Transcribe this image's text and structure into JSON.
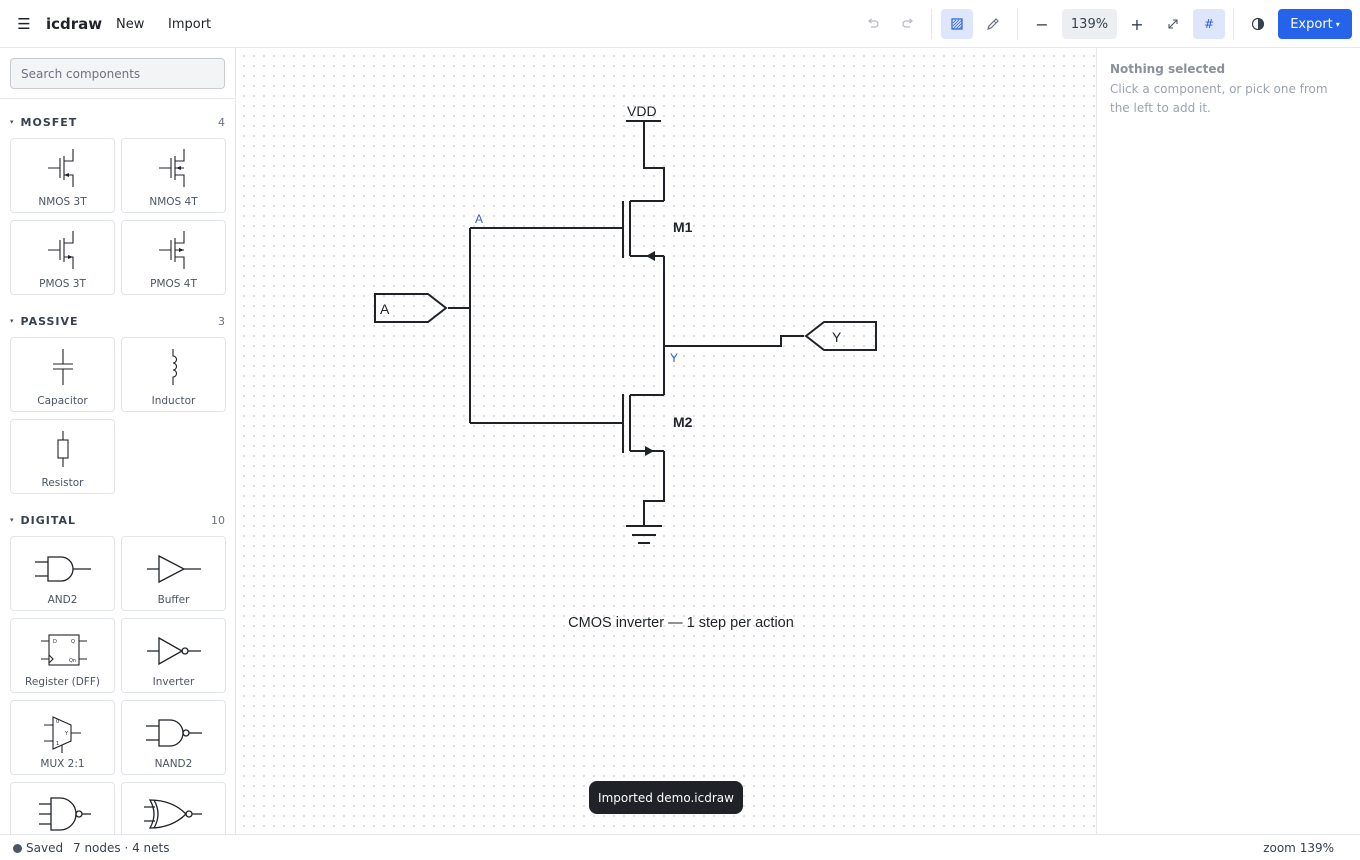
{
  "app": {
    "menu_icon": "hamburger-icon",
    "name": "icdraw",
    "menu": {
      "new": "New",
      "import": "Import"
    }
  },
  "toolbar": {
    "undo_icon": "undo-icon",
    "redo_icon": "redo-icon",
    "select_tool_icon": "select-tool-icon",
    "wire_tool_icon": "pencil-icon",
    "zoom_out": "−",
    "zoom_level": "139%",
    "zoom_in": "+",
    "fit_icon": "fit-view-icon",
    "grid_toggle": "#",
    "theme_icon": "contrast-icon",
    "export_label": "Export",
    "export_caret": "▾"
  },
  "sidebar": {
    "search_placeholder": "Search components",
    "sections": [
      {
        "title": "MOSFET",
        "count": "4",
        "items": [
          "NMOS 3T",
          "NMOS 4T",
          "PMOS 3T",
          "PMOS 4T"
        ]
      },
      {
        "title": "PASSIVE",
        "count": "3",
        "items": [
          "Capacitor",
          "Inductor",
          "Resistor"
        ]
      },
      {
        "title": "DIGITAL",
        "count": "10",
        "items": [
          "AND2",
          "Buffer",
          "Register (DFF)",
          "Inverter",
          "MUX 2:1",
          "NAND2"
        ]
      }
    ],
    "dff_pins": {
      "d": "D",
      "q": "Q",
      "qn": "Qn"
    },
    "mux_pins": {
      "y": "Y"
    }
  },
  "canvas": {
    "vdd_label": "VDD",
    "net_a": "A",
    "net_y": "Y",
    "m1_label": "M1",
    "m2_label": "M2",
    "input_port": "A",
    "output_port": "Y",
    "caption": "CMOS inverter — 1 step per action",
    "toast": "Imported demo.icdraw"
  },
  "inspector": {
    "title": "Nothing selected",
    "hint": "Click a component, or pick one from the left to add it."
  },
  "status": {
    "saved": "Saved",
    "counts": "7 nodes · 4 nets",
    "zoom": "zoom 139%"
  },
  "colors": {
    "accent": "#2563eb",
    "active_tool_bg": "#dde6fb",
    "net_label": "#2b5fd9",
    "wire": "#1f2328"
  }
}
